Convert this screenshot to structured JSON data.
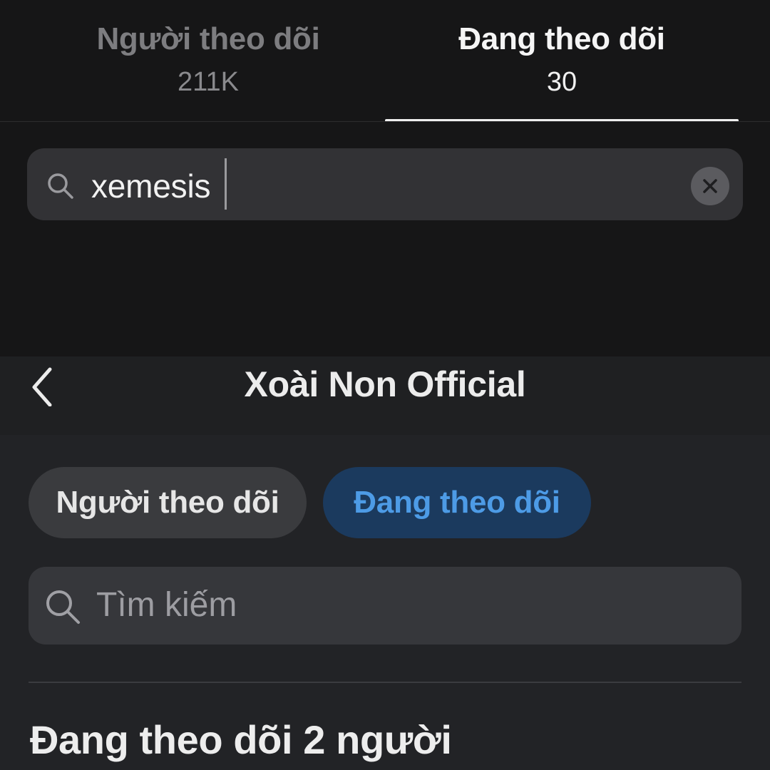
{
  "top": {
    "tabs": [
      {
        "label": "Người theo dõi",
        "count": "211K"
      },
      {
        "label": "Đang theo dõi",
        "count": "30"
      }
    ],
    "search": {
      "value": "xemesis"
    }
  },
  "bottom": {
    "title": "Xoài Non Official",
    "pills": [
      {
        "label": "Người theo dõi"
      },
      {
        "label": "Đang theo dõi"
      }
    ],
    "search": {
      "placeholder": "Tìm kiếm"
    },
    "section_heading": "Đang theo dõi 2 người"
  },
  "colors": {
    "active_pill_bg": "#1b3a5e",
    "active_pill_text": "#4d9be6"
  },
  "icons": [
    "search-icon",
    "clear-icon",
    "back-chevron-icon"
  ]
}
